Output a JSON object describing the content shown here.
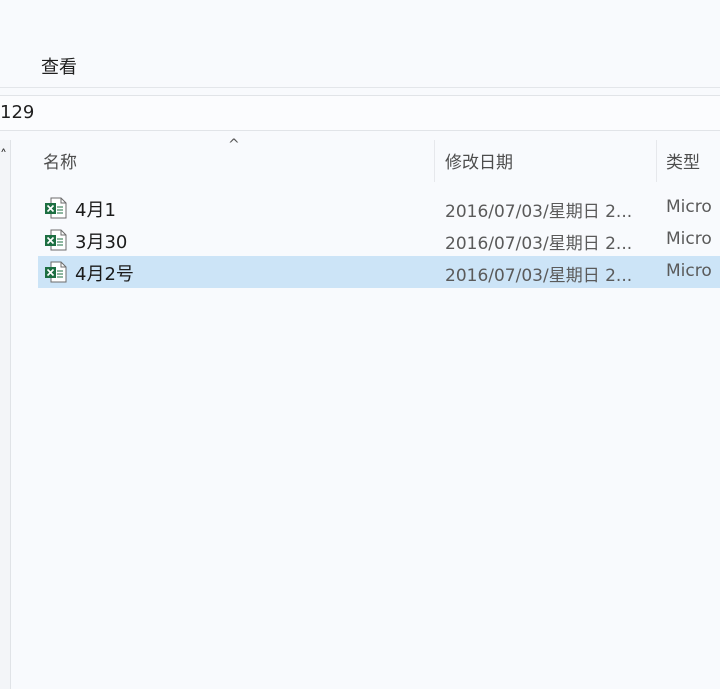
{
  "ribbon": {
    "tab_view": "查看"
  },
  "address": {
    "path_fragment": "129"
  },
  "columns": {
    "name": "名称",
    "modified": "修改日期",
    "type": "类型"
  },
  "sort": {
    "column": "name",
    "direction": "ascending"
  },
  "files": [
    {
      "name": "4月1",
      "modified": "2016/07/03/星期日 2...",
      "type": "Micro",
      "icon": "excel-file-icon",
      "selected": false
    },
    {
      "name": "3月30",
      "modified": "2016/07/03/星期日 2...",
      "type": "Micro",
      "icon": "excel-file-icon",
      "selected": false
    },
    {
      "name": "4月2号",
      "modified": "2016/07/03/星期日 2...",
      "type": "Micro",
      "icon": "excel-file-icon",
      "selected": true
    }
  ],
  "colors": {
    "selection": "#cce4f7",
    "excel_green": "#1d6f42",
    "background": "#f8fafd"
  }
}
